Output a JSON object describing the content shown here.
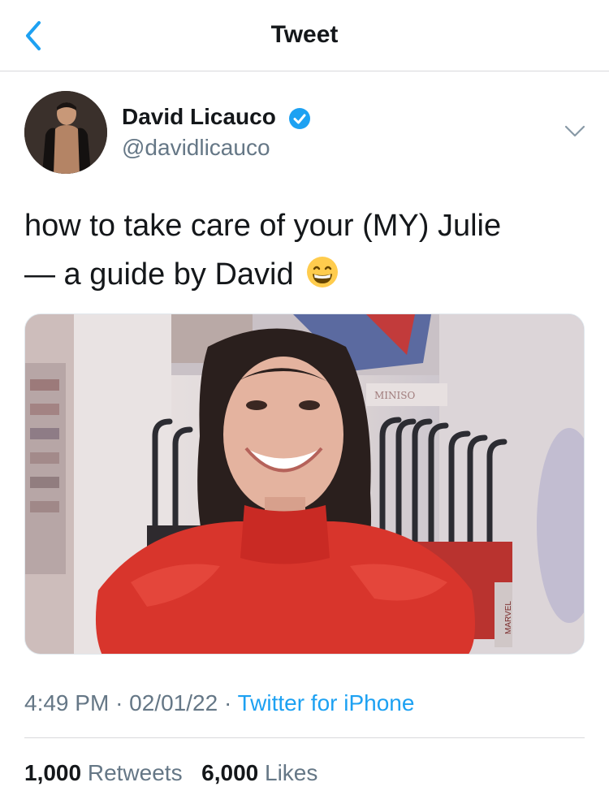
{
  "nav": {
    "title": "Tweet",
    "back_icon": "chevron-left-icon"
  },
  "tweet": {
    "author": {
      "name": "David Licauco",
      "handle": "@davidlicauco",
      "verified": true
    },
    "text_line1": "how to take care of your (MY) Julie",
    "text_line2": "— a guide by David",
    "emoji": "grinning-face-with-smiling-eyes",
    "time": "4:49 PM",
    "date": "02/01/22",
    "source": "Twitter for iPhone",
    "retweets_count": "1,000",
    "retweets_label": "Retweets",
    "likes_count": "6,000",
    "likes_label": "Likes",
    "media_sign": "MINISO",
    "media_tag": "MARVEL"
  },
  "colors": {
    "accent": "#1da1f2",
    "text_primary": "#14171a",
    "text_secondary": "#657786",
    "divider": "#d9d9dc"
  }
}
